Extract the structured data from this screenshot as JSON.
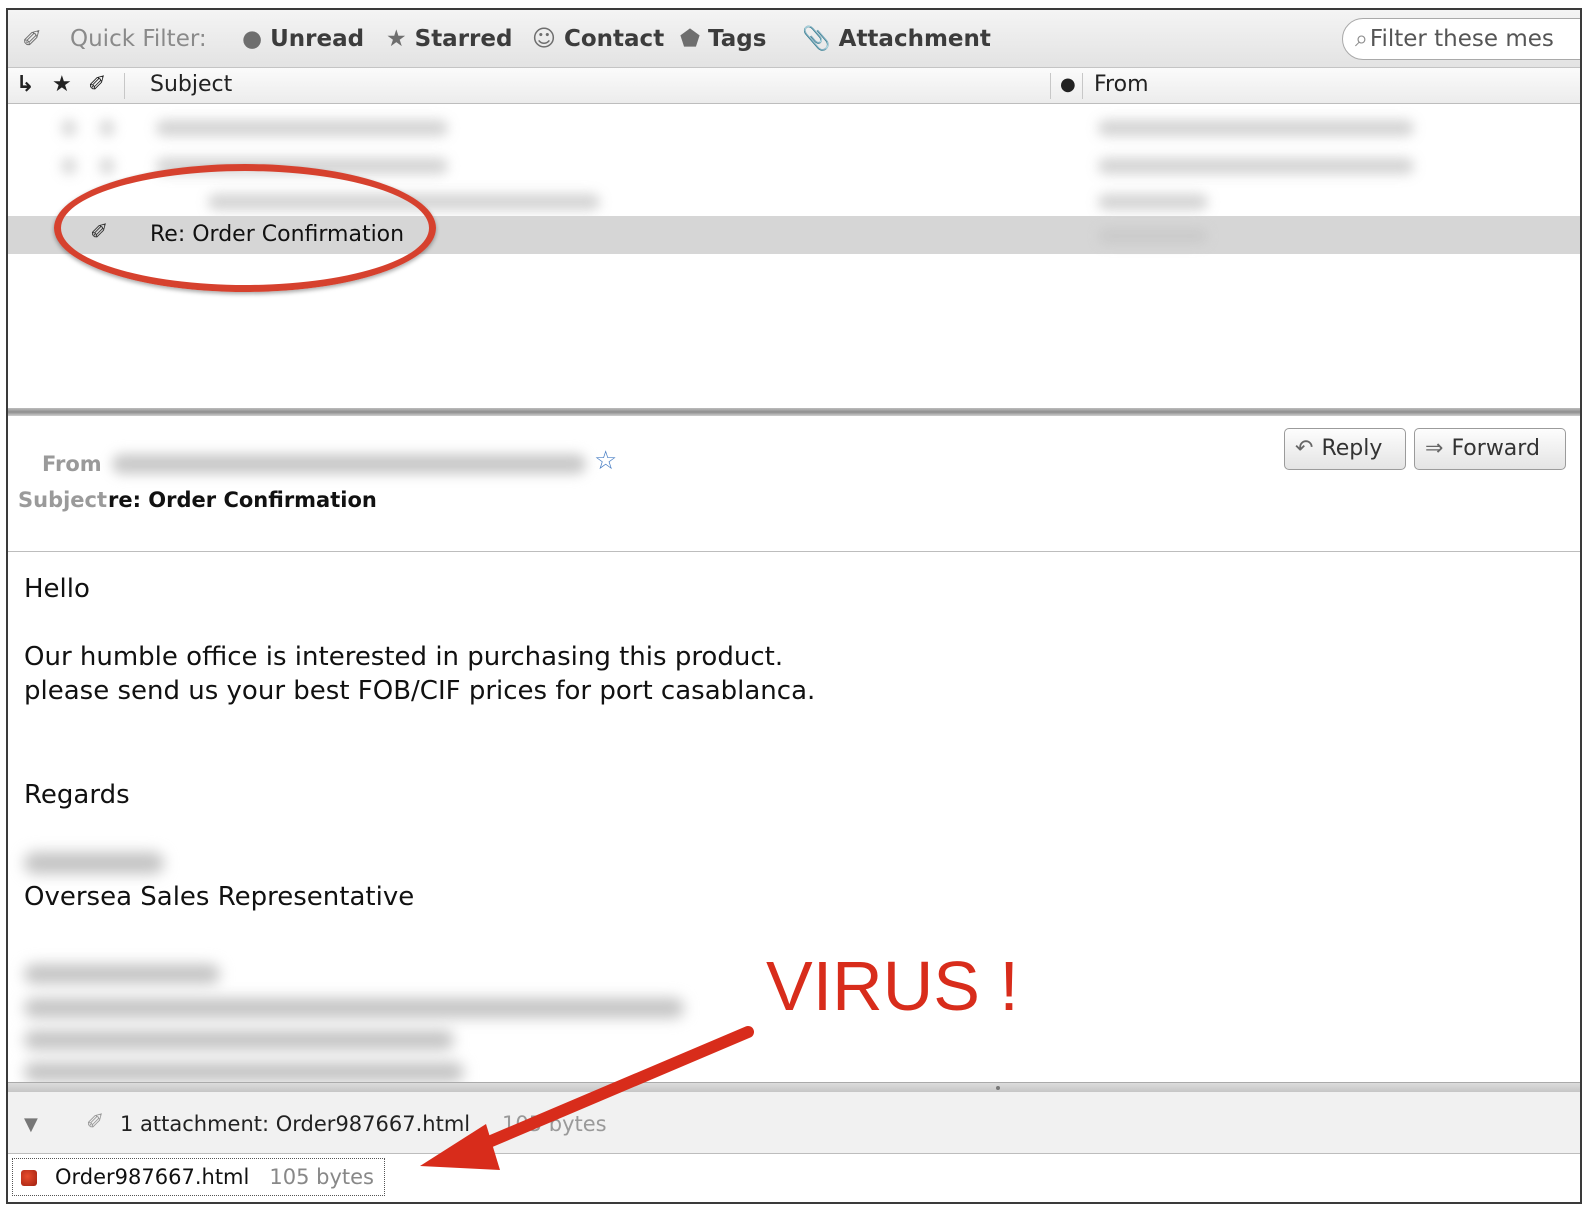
{
  "filter_bar": {
    "label": "Quick Filter:",
    "items": [
      {
        "label": "Unread",
        "icon": "dot-icon"
      },
      {
        "label": "Starred",
        "icon": "star-icon"
      },
      {
        "label": "Contact",
        "icon": "person-icon"
      },
      {
        "label": "Tags",
        "icon": "tag-icon"
      },
      {
        "label": "Attachment",
        "icon": "paperclip-icon"
      }
    ],
    "search_placeholder": "Filter these mes"
  },
  "columns": {
    "subject": "Subject",
    "from": "From"
  },
  "selected_message": {
    "subject": "Re: Order Confirmation"
  },
  "message_header": {
    "from_label": "From",
    "subject_label": "Subject",
    "subject_value": "re: Order Confirmation",
    "reply_label": "Reply",
    "forward_label": "Forward"
  },
  "body": {
    "greeting": "Hello",
    "line1": "Our humble office is interested in purchasing this product.",
    "line2": "please send us your best FOB/CIF prices for port casablanca.",
    "closing": "Regards",
    "title": "Oversea Sales Representative"
  },
  "annotation": {
    "text": "VIRUS !",
    "color": "#d82c1b"
  },
  "attachments": {
    "summary": "1 attachment: Order987667.html",
    "summary_size": "105 bytes",
    "items": [
      {
        "name": "Order987667.html",
        "size": "105 bytes"
      }
    ]
  },
  "colors": {
    "selection": "#d6d6d6",
    "highlight_ring": "#d6412e",
    "star_blue": "#4a7fc4"
  }
}
